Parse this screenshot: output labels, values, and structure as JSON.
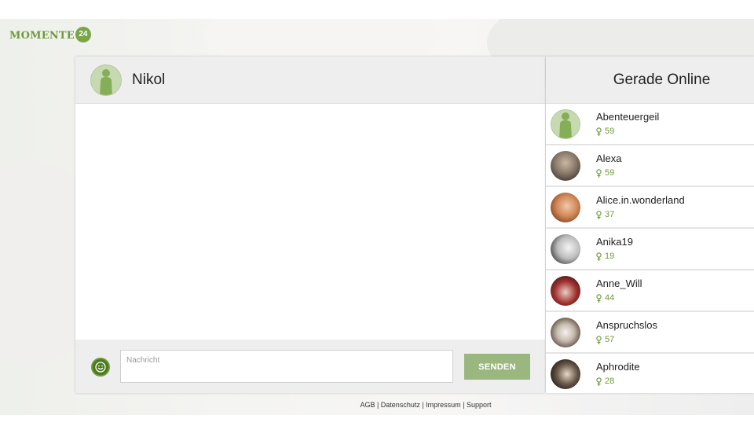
{
  "logo": {
    "text": "MOMENTE",
    "badge": "24"
  },
  "chat": {
    "partner_name": "Nikol",
    "input_placeholder": "Nachricht",
    "send_label": "SENDEN"
  },
  "online": {
    "title": "Gerade Online",
    "users": [
      {
        "name": "Abenteuergeil",
        "age": "59",
        "avatar": "default-silhouette"
      },
      {
        "name": "Alexa",
        "age": "59",
        "avatar": "photo"
      },
      {
        "name": "Alice.in.wonderland",
        "age": "37",
        "avatar": "photo"
      },
      {
        "name": "Anika19",
        "age": "19",
        "avatar": "photo"
      },
      {
        "name": "Anne_Will",
        "age": "44",
        "avatar": "photo"
      },
      {
        "name": "Anspruchslos",
        "age": "57",
        "avatar": "photo"
      },
      {
        "name": "Aphrodite",
        "age": "28",
        "avatar": "photo"
      }
    ]
  },
  "footer": {
    "links": [
      "AGB",
      "Datenschutz",
      "Impressum",
      "Support"
    ],
    "separator": " | "
  },
  "colors": {
    "brand_green": "#6f9a3e",
    "send_button": "#9bb780",
    "emoji_button": "#4a7a1c"
  },
  "icons": [
    "smiley-icon",
    "female-icon",
    "user-silhouette-icon"
  ]
}
